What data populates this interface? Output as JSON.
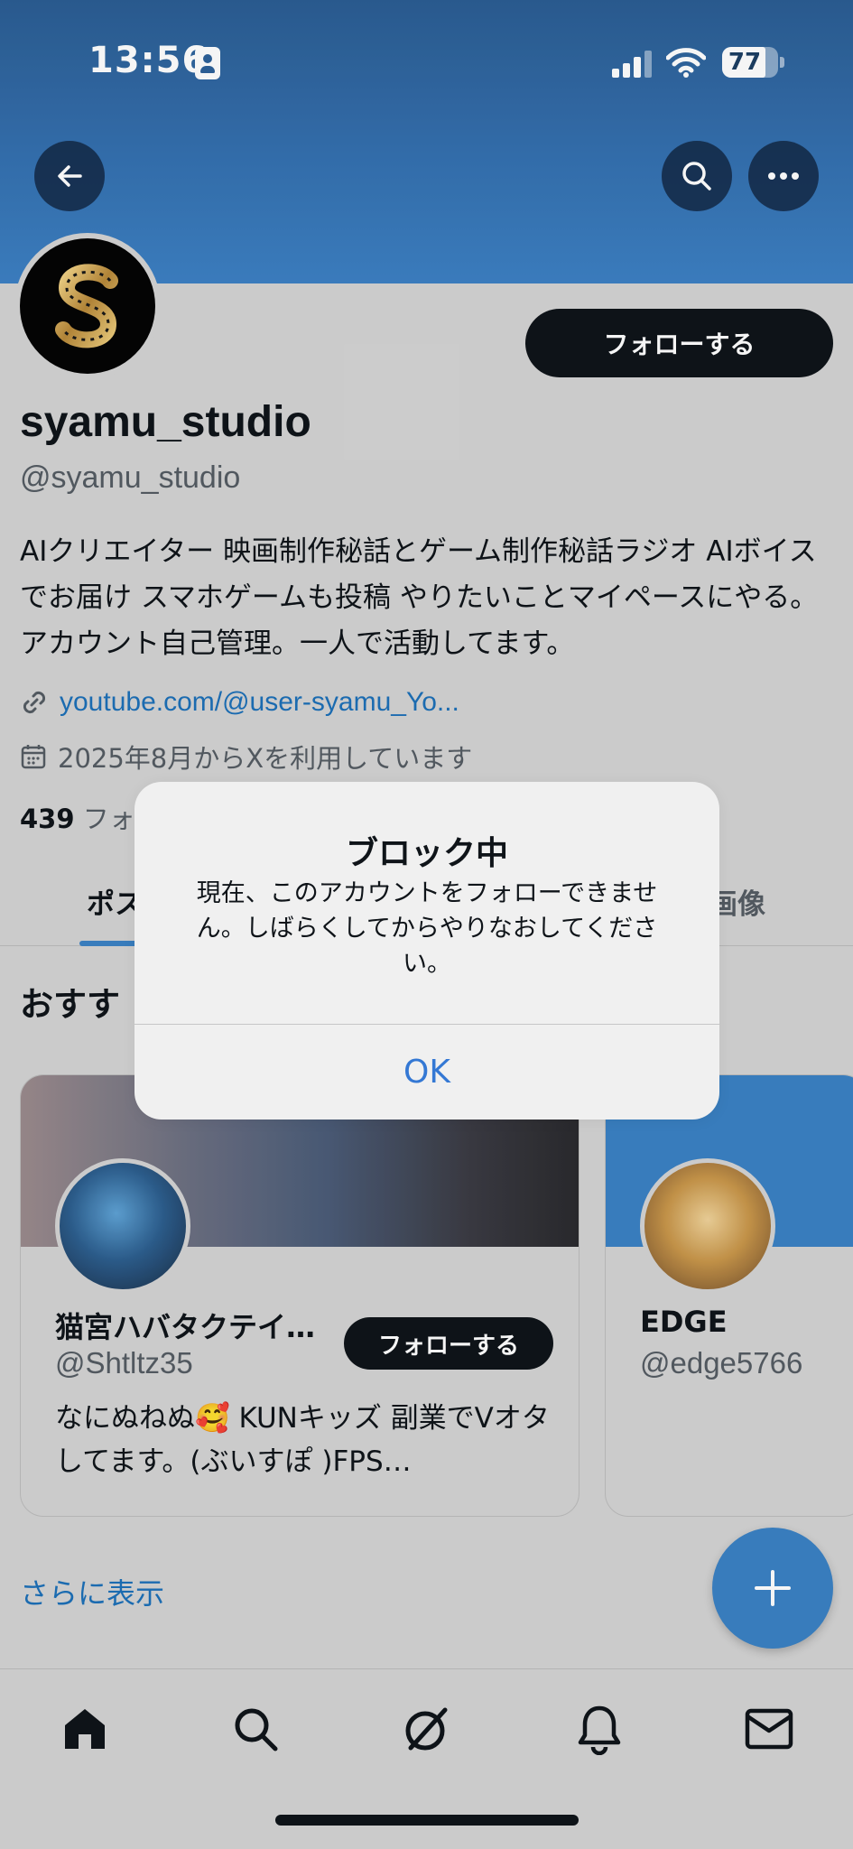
{
  "status_bar": {
    "time": "13:56",
    "battery": "77",
    "battery_level_percent": 77
  },
  "profile": {
    "display_name": "syamu_studio",
    "handle": "@syamu_studio",
    "follow_label": "フォローする",
    "bio": "AIクリエイター 映画制作秘話とゲーム制作秘話ラジオ AIボイスでお届け スマホゲームも投稿 やりたいことマイペースにやる。 アカウント自己管理。一人で活動してます。",
    "link": "youtube.com/@user-syamu_Yo...",
    "joined": "2025年8月からXを利用しています",
    "stats": {
      "count": "439",
      "label": "フォ"
    }
  },
  "tabs": [
    {
      "label": "ポス"
    },
    {
      "label": "画像"
    }
  ],
  "recommendations": {
    "heading": "おすす",
    "cards": [
      {
        "name": "猫宮ハバタクテイ…",
        "handle": "@Shtltz35",
        "follow_label": "フォローする",
        "bio": "なにぬねぬ🥰 KUNキッズ 副業でVオタしてます。(ぶいすぽ )FPS…"
      },
      {
        "name": "EDGE",
        "handle": "@edge5766"
      }
    ],
    "show_more": "さらに表示"
  },
  "bottom_nav": {
    "items": [
      "home-icon",
      "search-icon",
      "grok-icon",
      "bell-icon",
      "mail-icon"
    ]
  },
  "alert": {
    "title": "ブロック中",
    "message": "現在、このアカウントをフォローできません。しばらくしてからやりなおしてください。",
    "ok_label": "OK"
  },
  "colors": {
    "accent": "#3b82c4",
    "link": "#1d70b8",
    "dark_button": "#0f1419",
    "alert_button": "#3478d4"
  }
}
